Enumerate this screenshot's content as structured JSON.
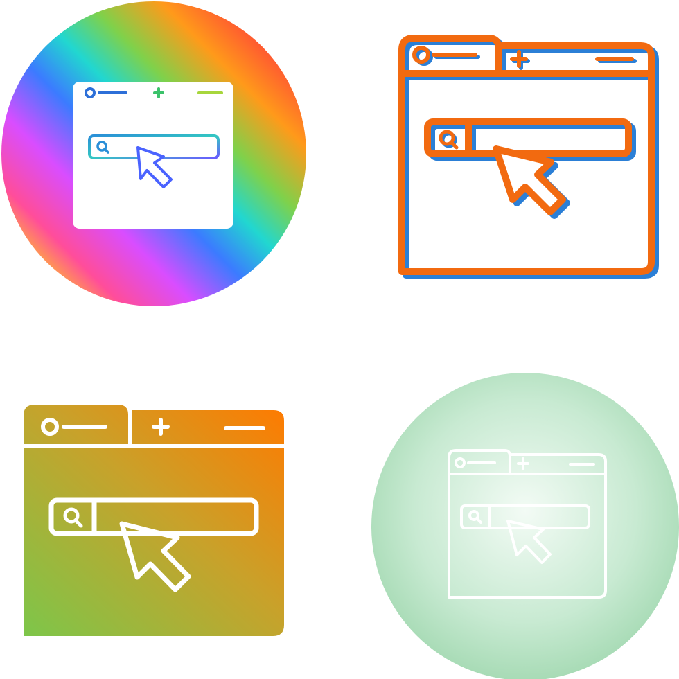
{
  "icons": [
    {
      "name": "browser-search-icon",
      "style": "gradient-circle"
    },
    {
      "name": "browser-search-icon",
      "style": "orange-outline"
    },
    {
      "name": "browser-search-icon",
      "style": "gradient-solid"
    },
    {
      "name": "browser-search-icon",
      "style": "light-circle-outline"
    }
  ],
  "colors": {
    "orange": "#f26a10",
    "blue": "#2b7fd6",
    "gradient_green": "#7dc64a",
    "gradient_orange": "#ff7a00",
    "pale_green": "#a9dcb6",
    "rainbow": [
      "#ff3b3b",
      "#ff9a1a",
      "#7fd14b",
      "#1fd6c6",
      "#3b7bff",
      "#c14dff",
      "#ff4da6"
    ]
  }
}
